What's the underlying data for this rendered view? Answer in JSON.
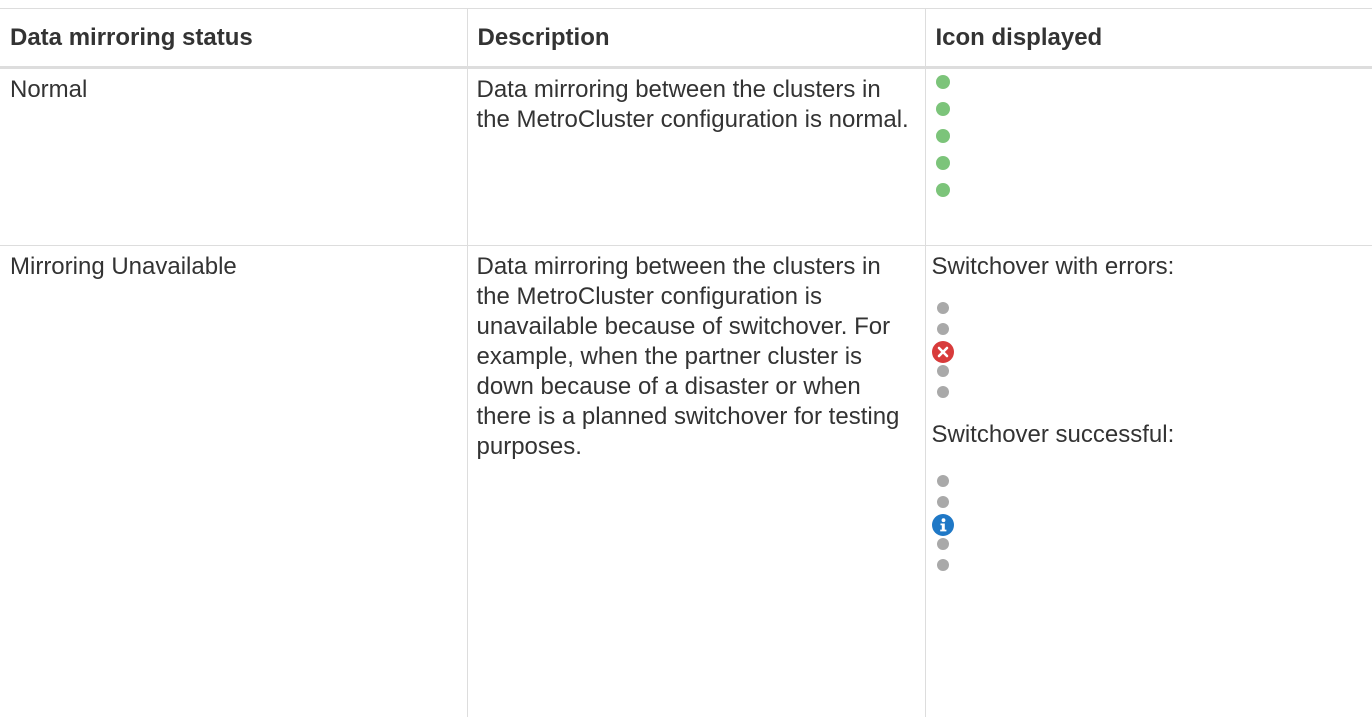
{
  "table": {
    "headers": [
      "Data mirroring status",
      "Description",
      "Icon displayed"
    ],
    "rows": [
      {
        "status": "Normal",
        "description": "Data mirroring between the clusters in the MetroCluster configuration is normal.",
        "icons": [
          "green-dot-icon",
          "green-dot-icon",
          "green-dot-icon",
          "green-dot-icon",
          "green-dot-icon"
        ]
      },
      {
        "status": "Mirroring Unavailable",
        "description": "Data mirroring between the clusters in the MetroCluster configuration is unavailable because of switchover. For example, when the partner cluster is down because of a disaster or when there is a planned switchover for testing purposes.",
        "switchover_errors_label": "Switchover with errors:",
        "switchover_errors_icons": [
          "gray-dot-icon",
          "gray-dot-icon",
          "error-x-icon",
          "gray-dot-icon",
          "gray-dot-icon"
        ],
        "switchover_success_label": "Switchover successful:",
        "switchover_success_icons": [
          "gray-dot-icon",
          "gray-dot-icon",
          "info-i-icon",
          "gray-dot-icon",
          "gray-dot-icon"
        ]
      }
    ]
  },
  "colors": {
    "green_dot": "#7cc47a",
    "gray_dot": "#a9a9a9",
    "error": "#d83b3b",
    "info": "#1f78c6",
    "border": "#dddddd",
    "text": "#333333"
  }
}
